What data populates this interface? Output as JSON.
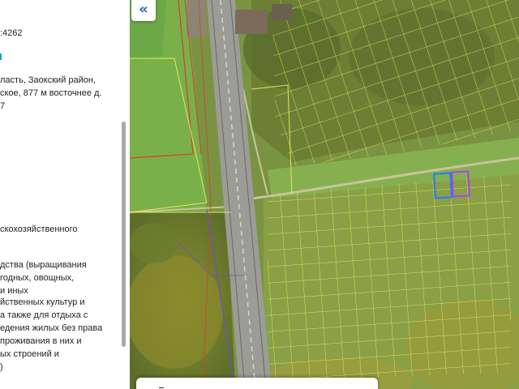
{
  "panel": {
    "cadastral_number_tail": ":4262",
    "address_line1": "ласть, Заокский район,",
    "address_line2": "ское, 877 м восточнее д.",
    "address_line3": "7",
    "category_line1": "скохозяйственного",
    "usage_lines": [
      "дства (выращивания",
      "годных, овощных,",
      "и иных",
      "йственных культур и",
      "а также для отдыха с",
      "едения жилых без права",
      "проживания в них и",
      "ых строений и",
      ")"
    ]
  },
  "map": {
    "collapse_icon": "«",
    "parcel_outline_color": "#e6e65a",
    "highlight_parcel_1_color": "#1e7bff",
    "highlight_parcel_2_color": "#b03cff"
  }
}
